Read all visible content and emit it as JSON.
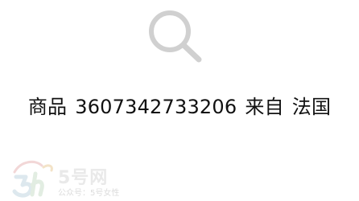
{
  "icons": {
    "search": "search-icon",
    "watermark_logo": "5h-logo-icon"
  },
  "result": {
    "prefix": "商品",
    "code": "3607342733206",
    "from_label": "来自",
    "country": "法国"
  },
  "watermark": {
    "title": "5号网",
    "subtitle": "公众号：5号女性"
  },
  "colors": {
    "icon_gray": "#d0d0d0",
    "text": "#111111",
    "watermark": "#e9e9e9"
  }
}
